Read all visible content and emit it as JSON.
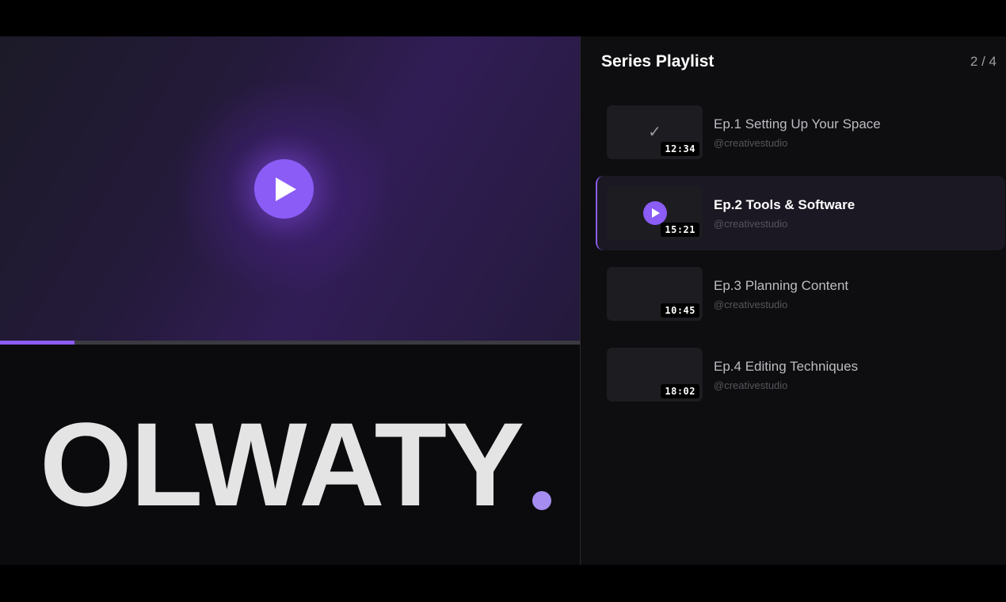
{
  "player": {
    "progress_fraction": 0.128,
    "play_icon": "play-icon",
    "accent_color": "#8b5cf6"
  },
  "brand": {
    "logo_text": "OLWATY",
    "dot_color": "#a48cf0"
  },
  "playlist": {
    "title": "Series Playlist",
    "count": "2 / 4",
    "items": [
      {
        "title": "Ep.1 Setting Up Your Space",
        "channel": "@creativestudio",
        "duration": "12:34",
        "state": "watched",
        "icon": "check-icon"
      },
      {
        "title": "Ep.2 Tools & Software",
        "channel": "@creativestudio",
        "duration": "15:21",
        "state": "playing",
        "icon": "play-icon"
      },
      {
        "title": "Ep.3 Planning Content",
        "channel": "@creativestudio",
        "duration": "10:45",
        "state": "unwatched"
      },
      {
        "title": "Ep.4 Editing Techniques",
        "channel": "@creativestudio",
        "duration": "18:02",
        "state": "unwatched"
      }
    ]
  }
}
